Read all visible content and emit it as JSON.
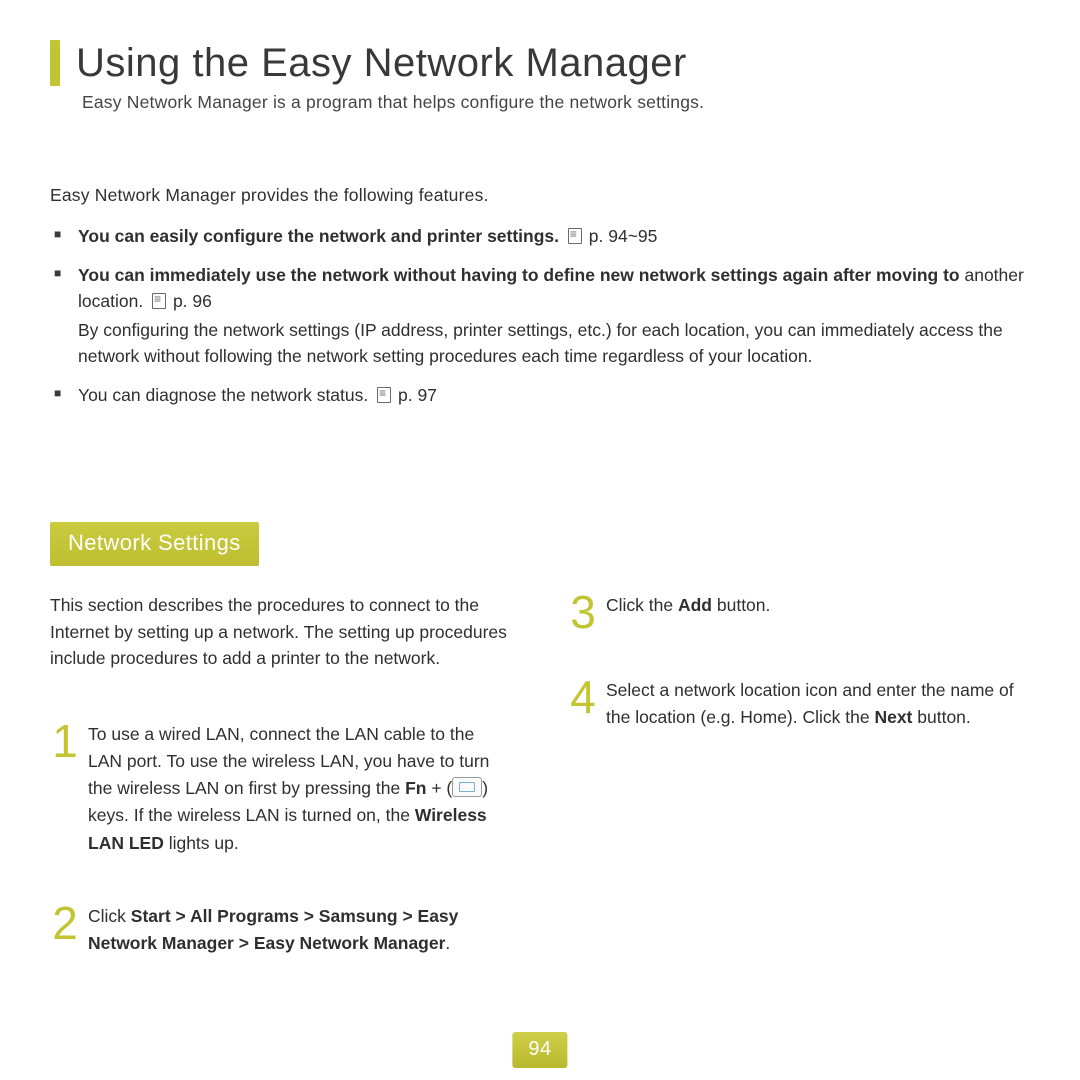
{
  "header": {
    "title": "Using the Easy Network Manager",
    "subtitle": "Easy Network Manager is a program that helps configure the network settings."
  },
  "features": {
    "lead": "Easy Network Manager provides the following features.",
    "items": [
      {
        "bold": "You can easily configure the network and printer settings.",
        "ref": "p. 94~95"
      },
      {
        "bold": "You can immediately use the network without having to define new network settings again after moving to",
        "cont": "another location.",
        "ref": "p. 96",
        "detail": "By configuring the network settings (IP address, printer settings, etc.) for each location, you can immediately access the network without following the network setting procedures each time regardless of your location."
      },
      {
        "plain": "You can diagnose the network status.",
        "ref": "p. 97"
      }
    ]
  },
  "section": {
    "badge": "Network Settings",
    "intro": "This section describes the procedures to connect to the Internet by setting up a network. The setting up procedures include procedures to add a printer to the network."
  },
  "steps": {
    "s1": {
      "num": "1",
      "a": "To use a wired LAN, connect the LAN cable to the LAN port. To use the wireless LAN, you have to turn the wireless LAN on first by pressing the ",
      "fn": "Fn",
      "plus": " + (",
      "b": ") keys. If the wireless LAN is turned on, the ",
      "led": "Wireless LAN LED",
      "c": " lights up."
    },
    "s2": {
      "num": "2",
      "a": "Click ",
      "path": "Start > All Programs > Samsung > Easy Network Manager > Easy Network Manager",
      "b": "."
    },
    "s3": {
      "num": "3",
      "a": "Click the ",
      "btn": "Add",
      "b": " button."
    },
    "s4": {
      "num": "4",
      "a": "Select a network location icon and enter the name of the location (e.g. Home). Click the ",
      "btn": "Next",
      "b": " button."
    }
  },
  "page_number": "94"
}
